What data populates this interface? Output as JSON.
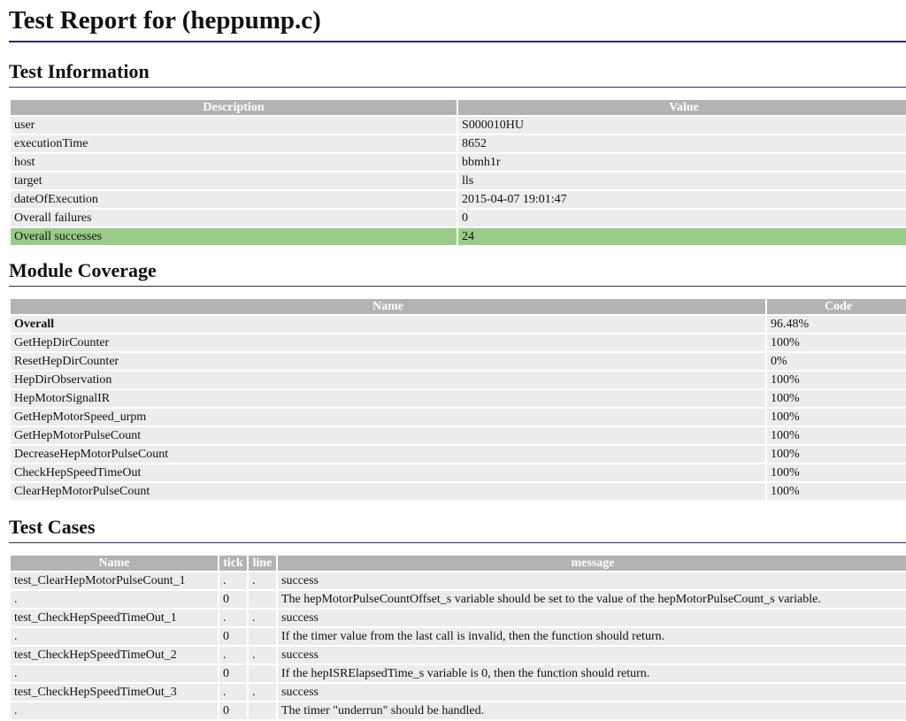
{
  "title": "Test Report for (heppump.c)",
  "info": {
    "heading": "Test Information",
    "headers": [
      "Description",
      "Value"
    ],
    "rows": [
      [
        "user",
        "S000010HU"
      ],
      [
        "executionTime",
        "8652"
      ],
      [
        "host",
        "bbmh1r"
      ],
      [
        "target",
        "lls"
      ],
      [
        "dateOfExecution",
        "2015-04-07 19:01:47"
      ],
      [
        "Overall failures",
        "0"
      ],
      [
        "Overall successes",
        "24"
      ]
    ]
  },
  "coverage": {
    "heading": "Module Coverage",
    "headers": [
      "Name",
      "Code"
    ],
    "rows": [
      [
        "Overall",
        "96.48%"
      ],
      [
        "GetHepDirCounter",
        "100%"
      ],
      [
        "ResetHepDirCounter",
        "0%"
      ],
      [
        "HepDirObservation",
        "100%"
      ],
      [
        "HepMotorSignalIR",
        "100%"
      ],
      [
        "GetHepMotorSpeed_urpm",
        "100%"
      ],
      [
        "GetHepMotorPulseCount",
        "100%"
      ],
      [
        "DecreaseHepMotorPulseCount",
        "100%"
      ],
      [
        "CheckHepSpeedTimeOut",
        "100%"
      ],
      [
        "ClearHepMotorPulseCount",
        "100%"
      ]
    ]
  },
  "cases": {
    "heading": "Test Cases",
    "headers": [
      "Name",
      "tick",
      "line",
      "message"
    ],
    "rows": [
      [
        "test_ClearHepMotorPulseCount_1",
        ".",
        ".",
        "success"
      ],
      [
        ".",
        "0",
        "",
        "The hepMotorPulseCountOffset_s variable should be set to the value of the hepMotorPulseCount_s variable."
      ],
      [
        "test_CheckHepSpeedTimeOut_1",
        ".",
        ".",
        "success"
      ],
      [
        ".",
        "0",
        "",
        "If the timer value from the last call is invalid, then the function should return."
      ],
      [
        "test_CheckHepSpeedTimeOut_2",
        ".",
        ".",
        "success"
      ],
      [
        ".",
        "0",
        "",
        "If the hepISRElapsedTime_s variable is 0, then the function should return."
      ],
      [
        "test_CheckHepSpeedTimeOut_3",
        ".",
        ".",
        "success"
      ],
      [
        ".",
        "0",
        "",
        "The timer \"underrun\" should be handled."
      ]
    ]
  },
  "colors": {
    "header_bg": "#b3b3b3",
    "row_bg": "#ececec",
    "success_bg": "#99cc88",
    "rule": "#2b2b6e"
  }
}
